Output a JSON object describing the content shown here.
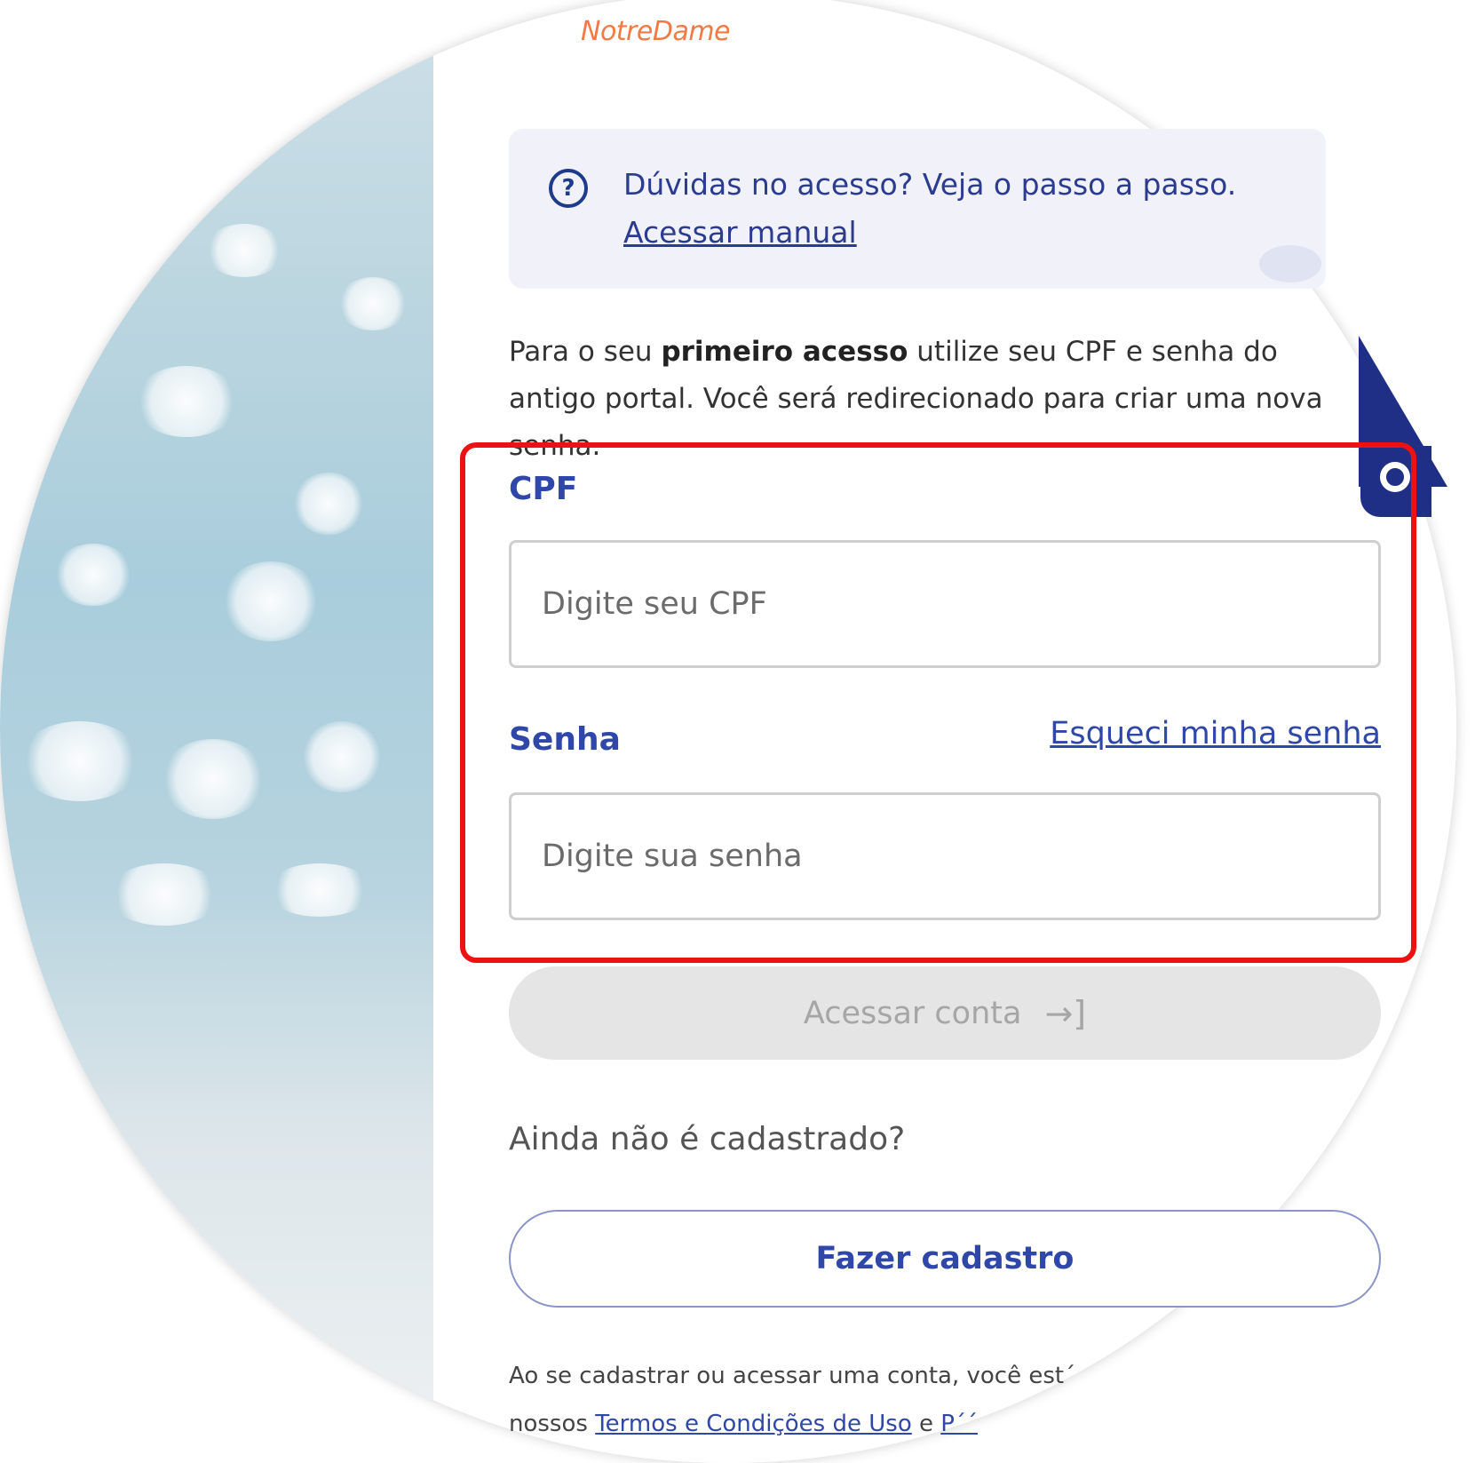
{
  "brand": "NotreDame",
  "help": {
    "title": "Dúvidas no acesso? Veja o passo a passo.",
    "link": "Acessar manual",
    "icon": "question-circle-icon"
  },
  "intro": {
    "prefix": "Para o seu ",
    "bold": "primeiro acesso",
    "suffix": " utilize seu CPF e senha do antigo portal. Você será redirecionado para criar uma nova senha."
  },
  "form": {
    "cpf_label": "CPF",
    "cpf_placeholder": "Digite seu CPF",
    "senha_label": "Senha",
    "senha_placeholder": "Digite sua senha",
    "forgot_link": "Esqueci minha senha",
    "submit_label": "Acessar conta",
    "submit_icon": "→]"
  },
  "signup": {
    "prompt": "Ainda não é cadastrado?",
    "button_label": "Fazer cadastro"
  },
  "terms": {
    "line1": "Ao se cadastrar ou acessar uma conta, você est´",
    "line2_prefix": "nossos ",
    "terms_link": "Termos e Condições de Uso",
    "line2_mid": " e ",
    "line2_tail": "P´´"
  },
  "colors": {
    "accent": "#2f47a8",
    "brand": "#f07a45",
    "highlight": "#ee1111",
    "disabled_bg": "#e5e5e5"
  }
}
